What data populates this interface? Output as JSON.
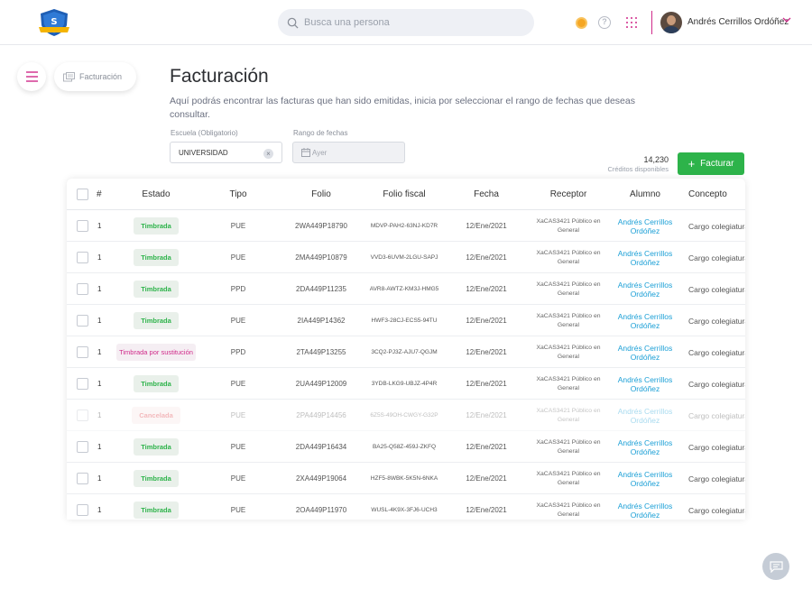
{
  "header": {
    "search_placeholder": "Busca una persona",
    "user_name": "Andrés Cerrillos Ordóñez"
  },
  "sidebar": {
    "breadcrumb": "Facturación"
  },
  "page": {
    "title": "Facturación",
    "description": "Aquí podrás encontrar las facturas que han sido emitidas, inicia por seleccionar el rango de fechas que deseas consultar."
  },
  "filters": {
    "school_label": "Escuela (Obligatorio)",
    "school_value": "UNIVERSIDAD",
    "date_label": "Rango de fechas",
    "date_placeholder": "Ayer"
  },
  "credits": {
    "value": "14,230",
    "label": "Créditos disponibles"
  },
  "actions": {
    "invoice_button": "Facturar"
  },
  "table": {
    "columns": [
      "#",
      "Estado",
      "Tipo",
      "Folio",
      "Folio fiscal",
      "Fecha",
      "Receptor",
      "Alumno",
      "Concepto"
    ],
    "rows": [
      {
        "num": "1",
        "estado": "Timbrada",
        "tipo": "PUE",
        "folio": "2WA449P18790",
        "fiscal": "MDVP-PAH2-63NJ-KD7R",
        "fecha": "12/Ene/2021",
        "receptor_1": "XaCAS3421 Público en",
        "receptor_2": "General",
        "alumno_1": "Andrés Cerrillos",
        "alumno_2": "Ordóñez",
        "concepto": "Cargo colegiatura"
      },
      {
        "num": "1",
        "estado": "Timbrada",
        "tipo": "PUE",
        "folio": "2MA449P10879",
        "fiscal": "VVD3-6UVM-2LGU-SAPJ",
        "fecha": "12/Ene/2021",
        "receptor_1": "XaCAS3421 Público en",
        "receptor_2": "General",
        "alumno_1": "Andrés Cerrillos",
        "alumno_2": "Ordóñez",
        "concepto": "Cargo colegiatura"
      },
      {
        "num": "1",
        "estado": "Timbrada",
        "tipo": "PPD",
        "folio": "2DA449P11235",
        "fiscal": "AVR8-AWTZ-KM3J-HMG5",
        "fecha": "12/Ene/2021",
        "receptor_1": "XaCAS3421 Público en",
        "receptor_2": "General",
        "alumno_1": "Andrés Cerrillos",
        "alumno_2": "Ordóñez",
        "concepto": "Cargo colegiatura"
      },
      {
        "num": "1",
        "estado": "Timbrada",
        "tipo": "PUE",
        "folio": "2IA449P14362",
        "fiscal": "HWF3-28CJ-ECS5-94TU",
        "fecha": "12/Ene/2021",
        "receptor_1": "XaCAS3421 Público en",
        "receptor_2": "General",
        "alumno_1": "Andrés Cerrillos",
        "alumno_2": "Ordóñez",
        "concepto": "Cargo colegiatura"
      },
      {
        "num": "1",
        "estado": "Timbrada por sustitución",
        "tipo": "PPD",
        "folio": "2TA449P13255",
        "fiscal": "3CQ2-PJ3Z-AJU7-QGJM",
        "fecha": "12/Ene/2021",
        "receptor_1": "XaCAS3421 Público en",
        "receptor_2": "General",
        "alumno_1": "Andrés Cerrillos",
        "alumno_2": "Ordóñez",
        "concepto": "Cargo colegiatura"
      },
      {
        "num": "1",
        "estado": "Timbrada",
        "tipo": "PUE",
        "folio": "2UA449P12009",
        "fiscal": "3YDB-LKG9-UBJZ-4P4R",
        "fecha": "12/Ene/2021",
        "receptor_1": "XaCAS3421 Público en",
        "receptor_2": "General",
        "alumno_1": "Andrés Cerrillos",
        "alumno_2": "Ordóñez",
        "concepto": "Cargo colegiatura"
      },
      {
        "num": "1",
        "estado": "Cancelada",
        "tipo": "PUE",
        "folio": "2PA449P14456",
        "fiscal": "6Z5S-49OH-CWGY-G32P",
        "fecha": "12/Ene/2021",
        "receptor_1": "XaCAS3421 Público en",
        "receptor_2": "General",
        "alumno_1": "Andrés Cerrillos",
        "alumno_2": "Ordóñez",
        "concepto": "Cargo colegiatura"
      },
      {
        "num": "1",
        "estado": "Timbrada",
        "tipo": "PUE",
        "folio": "2DA449P16434",
        "fiscal": "BA25-Q58Z-459J-ZKFQ",
        "fecha": "12/Ene/2021",
        "receptor_1": "XaCAS3421 Público en",
        "receptor_2": "General",
        "alumno_1": "Andrés Cerrillos",
        "alumno_2": "Ordóñez",
        "concepto": "Cargo colegiatura"
      },
      {
        "num": "1",
        "estado": "Timbrada",
        "tipo": "PUE",
        "folio": "2XA449P19064",
        "fiscal": "HZF5-8WBK-5K5N-6NKA",
        "fecha": "12/Ene/2021",
        "receptor_1": "XaCAS3421 Público en",
        "receptor_2": "General",
        "alumno_1": "Andrés Cerrillos",
        "alumno_2": "Ordóñez",
        "concepto": "Cargo colegiatura"
      },
      {
        "num": "1",
        "estado": "Timbrada",
        "tipo": "PUE",
        "folio": "2OA449P11970",
        "fiscal": "WUSL-4K9X-3FJ6-UCH3",
        "fecha": "12/Ene/2021",
        "receptor_1": "XaCAS3421 Público en",
        "receptor_2": "General",
        "alumno_1": "Andrés Cerrillos",
        "alumno_2": "Ordóñez",
        "concepto": "Cargo colegiatura"
      }
    ]
  },
  "colors": {
    "accent": "#d02a8a",
    "primary_button": "#2db34a",
    "link": "#1a9fd6",
    "status_ok": "#2db34a",
    "status_cancel": "#e0484f"
  }
}
